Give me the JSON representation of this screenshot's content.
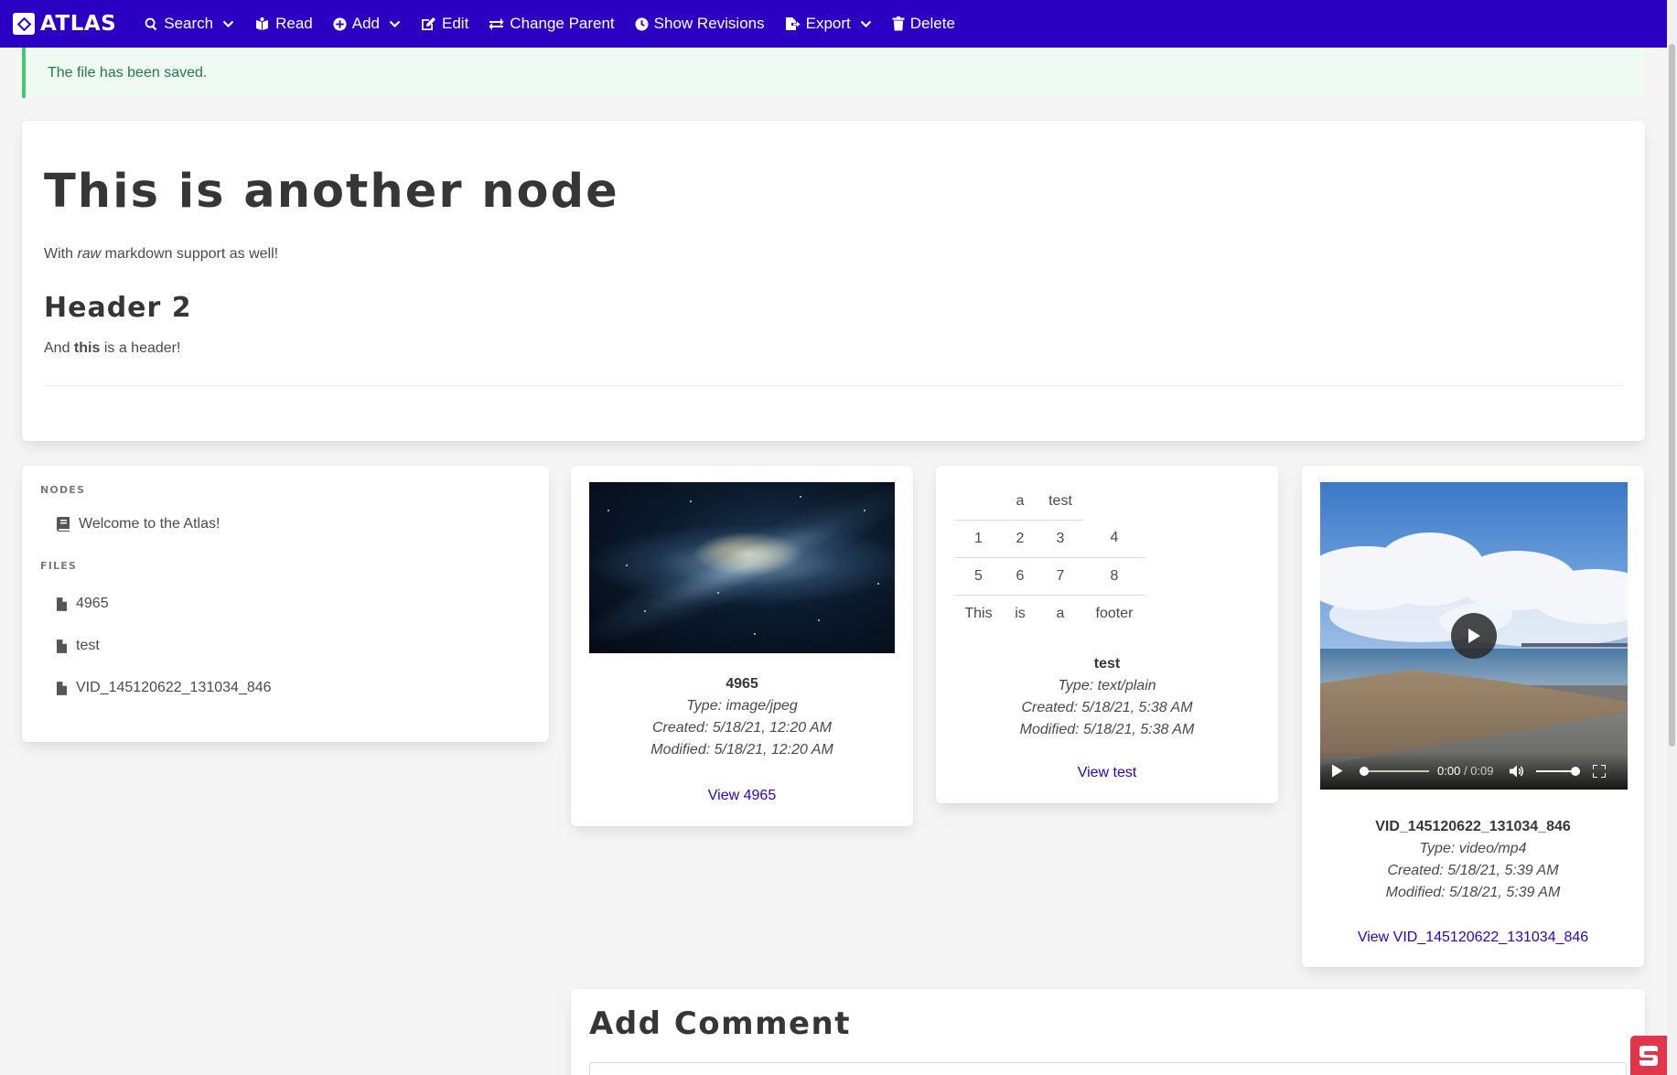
{
  "navbar": {
    "brand": "ATLAS",
    "items": [
      {
        "label": "Search",
        "dropdown": true
      },
      {
        "label": "Read",
        "dropdown": false
      },
      {
        "label": "Add",
        "dropdown": true
      },
      {
        "label": "Edit",
        "dropdown": false
      },
      {
        "label": "Change Parent",
        "dropdown": false
      },
      {
        "label": "Show Revisions",
        "dropdown": false
      },
      {
        "label": "Export",
        "dropdown": true
      },
      {
        "label": "Delete",
        "dropdown": false
      }
    ]
  },
  "notification": {
    "text": "The file has been saved."
  },
  "node": {
    "title": "This is another node",
    "para1": {
      "before": "With ",
      "em": "raw",
      "after": " markdown support as well!"
    },
    "header2": "Header 2",
    "para2": {
      "before": "And ",
      "strong": "this",
      "after": " is a header!"
    }
  },
  "sidebar": {
    "nodes_label": "Nodes",
    "nodes": [
      "Welcome to the Atlas!"
    ],
    "files_label": "Files",
    "files": [
      "4965",
      "test",
      "VID_145120622_131034_846"
    ]
  },
  "files": [
    {
      "name": "4965",
      "type": "Type: image/jpeg",
      "created": "Created: 5/18/21, 12:20 AM",
      "modified": "Modified: 5/18/21, 12:20 AM",
      "link": "View 4965"
    },
    {
      "name": "test",
      "type": "Type: text/plain",
      "created": "Created: 5/18/21, 5:38 AM",
      "modified": "Modified: 5/18/21, 5:38 AM",
      "link": "View test"
    },
    {
      "name": "VID_145120622_131034_846",
      "type": "Type: video/mp4",
      "created": "Created: 5/18/21, 5:39 AM",
      "modified": "Modified: 5/18/21, 5:39 AM",
      "link": "View VID_145120622_131034_846"
    }
  ],
  "preview_table": {
    "header": [
      "",
      "a",
      "test",
      ""
    ],
    "rows": [
      [
        "1",
        "2",
        "3",
        "4"
      ],
      [
        "5",
        "6",
        "7",
        "8"
      ]
    ],
    "footer": [
      "This",
      "is",
      "a",
      "footer"
    ]
  },
  "video": {
    "current": "0:00",
    "separator": "/",
    "duration": "0:09",
    "progress": 0.0,
    "volume": 1.0
  },
  "comment": {
    "title": "Add Comment"
  },
  "colors": {
    "primary": "#2c00c2",
    "success": "#48c774",
    "success_text": "#257942"
  }
}
